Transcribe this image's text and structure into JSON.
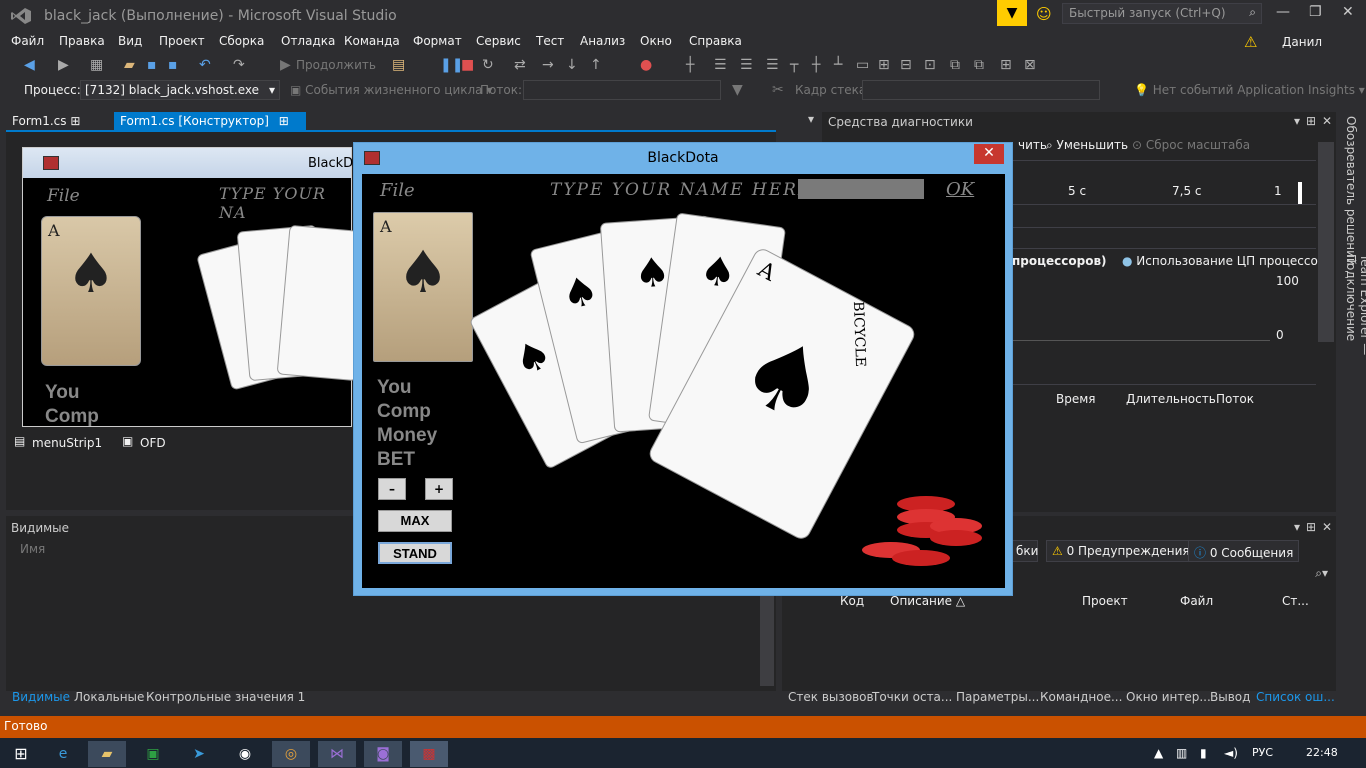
{
  "window": {
    "title": "black_jack (Выполнение) - Microsoft Visual Studio",
    "quick_launch": "Быстрый запуск (Ctrl+Q)",
    "user": "Данил"
  },
  "menu": [
    "Файл",
    "Правка",
    "Вид",
    "Проект",
    "Сборка",
    "Отладка",
    "Команда",
    "Формат",
    "Сервис",
    "Тест",
    "Анализ",
    "Окно",
    "Справка"
  ],
  "toolbar": {
    "continue": "Продолжить",
    "process_label": "Процесс:",
    "process_value": "[7132] black_jack.vshost.exe",
    "lifecycle": "События жизненного цикла",
    "thread_label": "Поток:",
    "stack_label": "Кадр стека:",
    "insights": "Нет событий Application Insights"
  },
  "tabs": {
    "tab1": "Form1.cs",
    "tab2": "Form1.cs [Конструктор]"
  },
  "designer": {
    "form_title": "BlackD",
    "file": "File",
    "type_name": "TYPE YOUR NA",
    "you": "You",
    "comp": "Comp"
  },
  "tray": {
    "menustrip": "menuStrip1",
    "ofd": "OFD"
  },
  "locals": {
    "title": "Видимые",
    "col_name": "Имя"
  },
  "bottom_left_tabs": [
    "Видимые",
    "Локальные",
    "Контрольные значения 1"
  ],
  "diag": {
    "title": "Средства диагностики",
    "zoom_in": "чить",
    "zoom_out": "Уменьшить",
    "reset": "Сброс масштаба",
    "t1": "5 с",
    "t2": "7,5 с",
    "t3": "1",
    "cpu_all": "процессоров)",
    "cpu_proc": "Использование ЦП процессом",
    "y_max": "100",
    "y_min": "0",
    "col_time": "Время",
    "col_duration": "Длительность",
    "col_thread": "Поток"
  },
  "errors": {
    "errors_chip": "бки",
    "warnings": "0 Предупреждения",
    "messages": "0 Сообщения",
    "col_code": "Код",
    "col_desc": "Описание",
    "col_project": "Проект",
    "col_file": "Файл",
    "col_line": "Ст..."
  },
  "bottom_right_tabs": [
    "Стек вызовов",
    "Точки оста...",
    "Параметры...",
    "Командное...",
    "Окно интер...",
    "Вывод",
    "Список ош..."
  ],
  "status": "Готово",
  "app": {
    "title": "BlackDota",
    "close": "✕",
    "file": "File",
    "type_name": "TYPE YOUR NAME HERE",
    "ok": "OK",
    "you": "You",
    "comp": "Comp",
    "money": "Money",
    "bet": "BET",
    "minus": "–",
    "plus": "+",
    "max": "MAX",
    "stand": "STAND",
    "card_rank": "A",
    "card_text": "BICYCLE"
  },
  "sidebar": {
    "solution": "Обозреватель решений",
    "team": "Team Explorer — Подключение"
  },
  "taskbar": {
    "lang": "РУС",
    "time": "22:48"
  }
}
